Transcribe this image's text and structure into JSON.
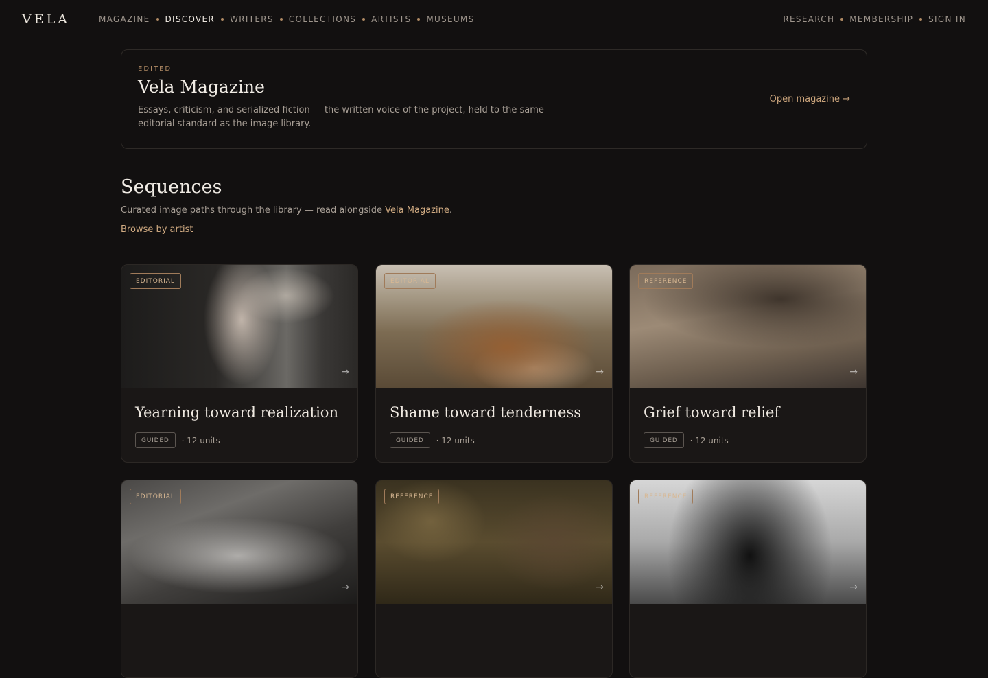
{
  "brand": "VELA",
  "nav": {
    "left": [
      "MAGAZINE",
      "DISCOVER",
      "WRITERS",
      "COLLECTIONS",
      "ARTISTS",
      "MUSEUMS"
    ],
    "active": "DISCOVER",
    "right": [
      "RESEARCH",
      "MEMBERSHIP",
      "SIGN IN"
    ]
  },
  "magazine": {
    "kicker": "EDITED",
    "title": "Vela Magazine",
    "description": "Essays, criticism, and serialized fiction — the written voice of the project, held to the same editorial standard as the image library.",
    "link": "Open magazine →"
  },
  "sequences": {
    "title": "Sequences",
    "subtitle_prefix": "Curated image paths through the library — read alongside ",
    "subtitle_link": "Vela Magazine",
    "subtitle_suffix": ".",
    "browse": "Browse by artist"
  },
  "cards": [
    {
      "badge": "EDITORIAL",
      "title": "Yearning toward realization",
      "tag": "GUIDED",
      "units": "· 12 units",
      "arrow": "→"
    },
    {
      "badge": "EDITORIAL",
      "title": "Shame toward tenderness",
      "tag": "GUIDED",
      "units": "· 12 units",
      "arrow": "→"
    },
    {
      "badge": "REFERENCE",
      "title": "Grief toward relief",
      "tag": "GUIDED",
      "units": "· 12 units",
      "arrow": "→"
    },
    {
      "badge": "EDITORIAL",
      "title": "",
      "tag": "",
      "units": "",
      "arrow": "→"
    },
    {
      "badge": "REFERENCE",
      "title": "",
      "tag": "",
      "units": "",
      "arrow": "→"
    },
    {
      "badge": "REFERENCE",
      "title": "",
      "tag": "",
      "units": "",
      "arrow": "→"
    }
  ]
}
